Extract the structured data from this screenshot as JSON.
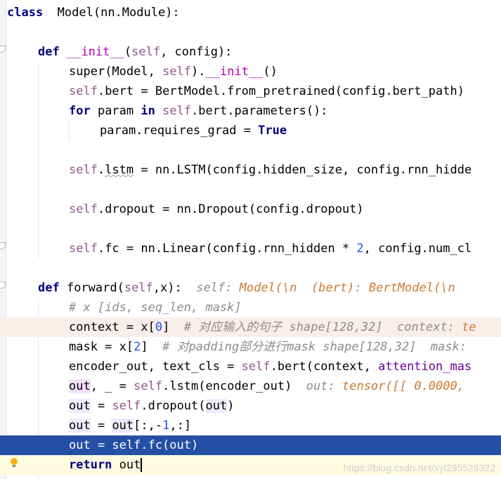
{
  "lines": [
    {
      "t": [
        [
          "kw",
          "class"
        ],
        [
          "",
          "  "
        ],
        [
          "",
          "Model(nn.Module):"
        ]
      ]
    },
    {
      "t": []
    },
    {
      "t": [
        [
          "kw",
          "def"
        ],
        [
          "",
          " "
        ],
        [
          "dunder",
          "__init__"
        ],
        [
          "",
          "("
        ],
        [
          "self",
          "self"
        ],
        [
          "",
          ", config):"
        ]
      ]
    },
    {
      "t": [
        [
          "",
          "super"
        ],
        [
          "",
          "(Model, "
        ],
        [
          "self",
          "self"
        ],
        [
          "",
          ")."
        ],
        [
          "dunder",
          "__init__"
        ],
        [
          "",
          "()"
        ]
      ]
    },
    {
      "t": [
        [
          "self",
          "self"
        ],
        [
          "",
          ".bert = BertModel.from_pretrained(config.bert_path)"
        ]
      ]
    },
    {
      "t": [
        [
          "kw",
          "for"
        ],
        [
          "",
          " param "
        ],
        [
          "kw",
          "in"
        ],
        [
          "",
          " "
        ],
        [
          "self",
          "self"
        ],
        [
          "",
          ".bert.parameters():"
        ]
      ]
    },
    {
      "t": [
        [
          "",
          "param.requires_grad = "
        ],
        [
          "kw",
          "True"
        ]
      ]
    },
    {
      "t": []
    },
    {
      "t": [
        [
          "self",
          "self"
        ],
        [
          "",
          "."
        ],
        [
          "under",
          "lstm"
        ],
        [
          "",
          " = nn.LSTM(config.hidden_size, config.rnn_hidde"
        ]
      ]
    },
    {
      "t": []
    },
    {
      "t": [
        [
          "self",
          "self"
        ],
        [
          "",
          ".dropout = nn.Dropout(config.dropout)"
        ]
      ]
    },
    {
      "t": []
    },
    {
      "t": [
        [
          "self",
          "self"
        ],
        [
          "",
          ".fc = nn.Linear(config.rnn_hidden * "
        ],
        [
          "num",
          "2"
        ],
        [
          "",
          ", config.num_cl"
        ]
      ]
    },
    {
      "t": []
    },
    {
      "t": [
        [
          "kw",
          "def"
        ],
        [
          "",
          " forward("
        ],
        [
          "self",
          "self"
        ],
        [
          "",
          ",x):  "
        ],
        [
          "inlay",
          "self: "
        ],
        [
          "inlay-v",
          "Model(\\n  (bert): BertModel(\\n"
        ]
      ]
    },
    {
      "t": [
        [
          "cm",
          "# x [ids, seq_len, mask]"
        ]
      ]
    },
    {
      "t": [
        [
          "",
          "context = x["
        ],
        [
          "num",
          "0"
        ],
        [
          "",
          "]  "
        ],
        [
          "cm",
          "# 对应输入的句子 shape[128,32]  "
        ],
        [
          "inlay",
          "context: "
        ],
        [
          "inlay-v",
          "te"
        ]
      ]
    },
    {
      "t": [
        [
          "",
          "mask = x["
        ],
        [
          "num",
          "2"
        ],
        [
          "",
          "]  "
        ],
        [
          "cm",
          "# 对padding部分进行mask shape[128,32]  "
        ],
        [
          "inlay",
          "mask: "
        ]
      ]
    },
    {
      "t": [
        [
          "",
          "encoder_out, text_cls = "
        ],
        [
          "self",
          "self"
        ],
        [
          "",
          ".bert(context, "
        ],
        [
          "param",
          "attention_mas"
        ]
      ]
    },
    {
      "t": [
        [
          "usage-r",
          "out"
        ],
        [
          "",
          ", _ = "
        ],
        [
          "self",
          "self"
        ],
        [
          "",
          ".lstm(encoder_out)  "
        ],
        [
          "inlay",
          "out: "
        ],
        [
          "inlay-v",
          "tensor([[ 0.0000,"
        ]
      ]
    },
    {
      "t": [
        [
          "usage-w",
          "out"
        ],
        [
          "",
          " = "
        ],
        [
          "self",
          "self"
        ],
        [
          "",
          ".dropout("
        ],
        [
          "usage-w",
          "out"
        ],
        [
          "",
          ")"
        ]
      ]
    },
    {
      "t": [
        [
          "usage-w",
          "out"
        ],
        [
          "",
          " = "
        ],
        [
          "usage-w",
          "out"
        ],
        [
          "",
          "[:,-"
        ],
        [
          "num",
          "1"
        ],
        [
          "",
          ",:]"
        ]
      ]
    },
    {
      "t": [
        [
          "",
          "out = self.fc(out)"
        ]
      ]
    },
    {
      "t": [
        [
          "kw",
          "return"
        ],
        [
          "",
          " "
        ],
        [
          "",
          "out"
        ]
      ]
    }
  ],
  "watermark": "https://blog.csdn.net/xyl295528322"
}
